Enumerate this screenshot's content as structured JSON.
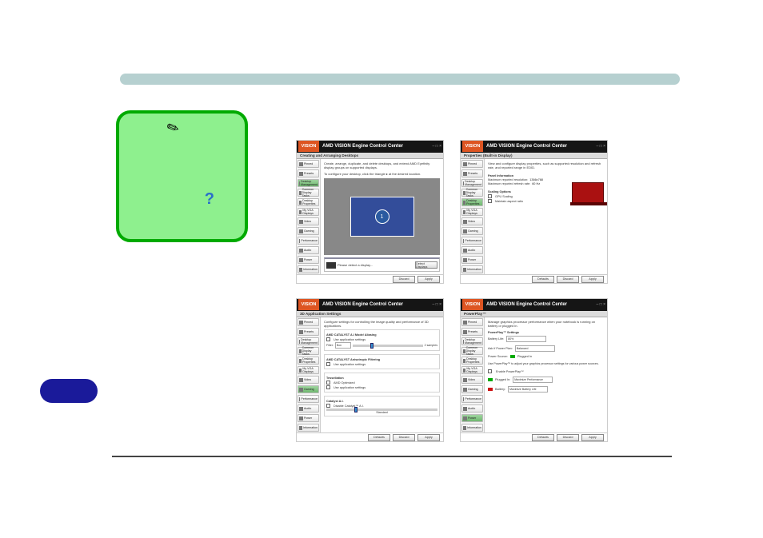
{
  "app_title": "AMD VISION Engine Control Center",
  "brand": "VISION",
  "panels": {
    "a": {
      "subheader": "Creating and Arranging Desktops",
      "desc": "Create, arrange, duplicate, and delete desktops, and extend AMD Eyefinity display groups on supported displays.",
      "hint": "To configure your desktop, click the triangle ▸ at the desired location.",
      "strip_label": "Please detect a display...",
      "strip_btn": "Detect Displays"
    },
    "b": {
      "subheader": "Properties (Built-in Display)",
      "desc": "View and configure display properties, such as supported resolution and refresh rate, and reported range in EDID.",
      "panel_info_title": "Panel Information",
      "max_res_label": "Maximum reported resolution:",
      "max_res_val": "1366x768",
      "max_rr_label": "Maximum reported refresh rate:",
      "max_rr_val": "60 Hz",
      "scaling_section": "Scaling Options",
      "gpu_scaling": "GPU Scaling",
      "maintain": "Maintain aspect ratio"
    },
    "c": {
      "subheader": "3D Application Settings",
      "desc": "Configure settings for controlling the image quality and performance of 3D applications.",
      "aa_grp_title": "AMD CATALYST A.I Mode/ Aliasing",
      "aa_use": "Use application settings",
      "aa_filter_label": "Filter:",
      "aa_filter_val": "Box",
      "aa_samples": "2 samples",
      "af_grp_title": "AMD CATALYST Anisotropic Filtering",
      "af_use": "Use application settings",
      "tess_title": "Tessellation",
      "tess_opt": "AMD Optimized",
      "tess_use": "Use application settings",
      "cat_ai_title": "Catalyst A.I.",
      "cat_ai_opt": "Disable Catalyst™ A.I.",
      "cat_ai_level": "Standard"
    },
    "d": {
      "subheader": "PowerPlay™",
      "desc": "Manage graphics processor performance when your notebook is running on battery or plugged in.",
      "pp_settings": "PowerPlay™ Settings",
      "batt_life_label": "Battery Life:",
      "batt_life_val": "80%",
      "askfirst_label": "Ask if Power Plan:",
      "askfirst_val": "Balanced",
      "power_source_label": "Power Source:",
      "power_source_val": "Plugged In",
      "subdesc": "Use PowerPlay™ to adjust your graphics processor settings for various power sources.",
      "enable_pp": "Enable PowerPlay™",
      "plugged_label": "Plugged In:",
      "plugged_val": "Maximize Performance",
      "batt_label": "Battery:",
      "batt_val": "Maximize Battery Life"
    }
  },
  "sidebar": {
    "items": [
      "Pinned",
      "Presets",
      "Desktop Management",
      "Common Display Tasks",
      "Desktop Properties",
      "My VGA Displays",
      "Video",
      "Gaming",
      "Performance",
      "Audio",
      "Power",
      "Information"
    ],
    "sel_a": 2,
    "sel_b": 4,
    "sel_c": 7,
    "sel_d": 10
  },
  "footer_buttons": {
    "apply": "Apply",
    "discard": "Discard",
    "defaults": "Defaults"
  }
}
